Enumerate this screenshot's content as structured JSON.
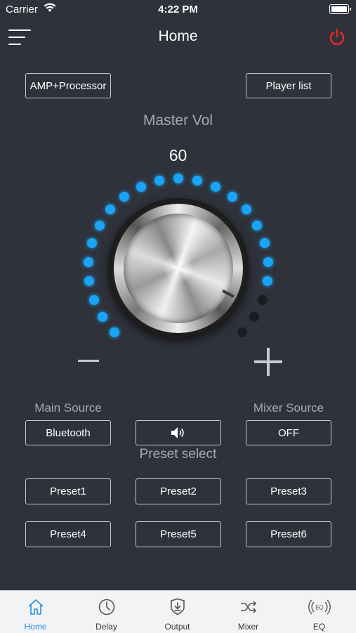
{
  "status_bar": {
    "carrier": "Carrier",
    "time": "4:22 PM"
  },
  "nav": {
    "title": "Home"
  },
  "top_buttons": {
    "amp": "AMP+Processor",
    "player_list": "Player list"
  },
  "master": {
    "label": "Master Vol",
    "value": "60",
    "level_fraction": 0.85
  },
  "sources": {
    "main_label": "Main Source",
    "main_value": "Bluetooth",
    "mixer_label": "Mixer Source",
    "mixer_value": "OFF"
  },
  "preset_label": "Preset select",
  "presets": [
    "Preset1",
    "Preset2",
    "Preset3",
    "Preset4",
    "Preset5",
    "Preset6"
  ],
  "tabs": [
    {
      "label": "Home",
      "icon": "home-icon",
      "active": true
    },
    {
      "label": "Delay",
      "icon": "clock-icon",
      "active": false
    },
    {
      "label": "Output",
      "icon": "output-icon",
      "active": false
    },
    {
      "label": "Mixer",
      "icon": "shuffle-icon",
      "active": false
    },
    {
      "label": "EQ",
      "icon": "eq-icon",
      "active": false
    }
  ],
  "colors": {
    "background": "#2f323b",
    "accent": "#19a4f5",
    "power": "#e02727",
    "tab_active": "#1e8fe6"
  }
}
